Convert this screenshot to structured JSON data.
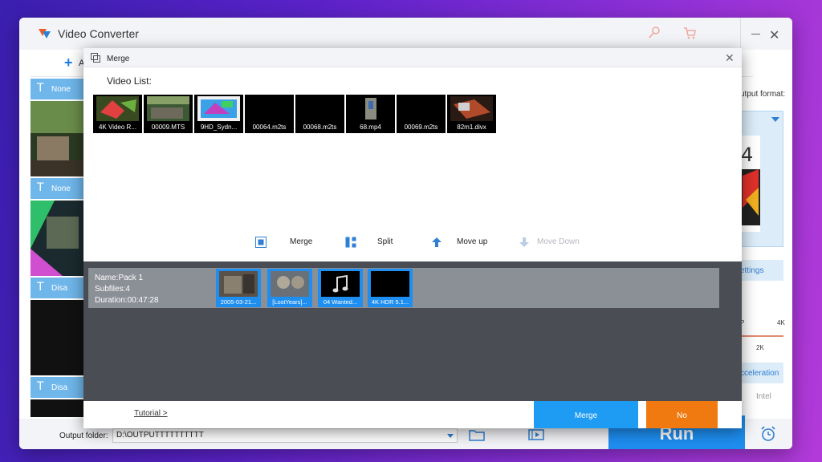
{
  "app": {
    "title": "Video Converter",
    "add_label": "A",
    "output_format_label": "utput format:",
    "settings_label": "ettings",
    "ticks": {
      "p": "P",
      "four_k": "4K",
      "two_k": "2K"
    },
    "acceleration_label": "cceleration",
    "intel_label": "Intel",
    "output_folder_label": "Output folder:",
    "output_folder_value": "D:\\OUTPUTTTTTTTTTT",
    "run_label": "Run",
    "strips": [
      {
        "label": "None"
      },
      {
        "label": "None"
      },
      {
        "label": "Disa"
      },
      {
        "label": "Disa"
      }
    ],
    "colors": {
      "accent": "#1e8ef0",
      "no_button": "#f07a10"
    }
  },
  "dialog": {
    "title": "Merge",
    "video_list_label": "Video List:",
    "videos": [
      {
        "name": "4K Video R..."
      },
      {
        "name": "00009.MTS"
      },
      {
        "name": "9HD_Sydn..."
      },
      {
        "name": "00064.m2ts"
      },
      {
        "name": "00068.m2ts"
      },
      {
        "name": "68.mp4"
      },
      {
        "name": "00069.m2ts"
      },
      {
        "name": "82m1.divx"
      }
    ],
    "actions": {
      "merge": "Merge",
      "split": "Split",
      "move_up": "Move up",
      "move_down": "Move Down"
    },
    "pack": {
      "name": "Name:Pack 1",
      "subfiles": "Subfiles:4",
      "duration": "Duration:00:47:28",
      "files": [
        {
          "name": "2005-03-21..."
        },
        {
          "name": "[LostYears]..."
        },
        {
          "name": "04 Wanted..."
        },
        {
          "name": "4K HDR 5.1..."
        }
      ]
    },
    "tutorial_label": "Tutorial >",
    "merge_button": "Merge",
    "no_button": "No"
  }
}
